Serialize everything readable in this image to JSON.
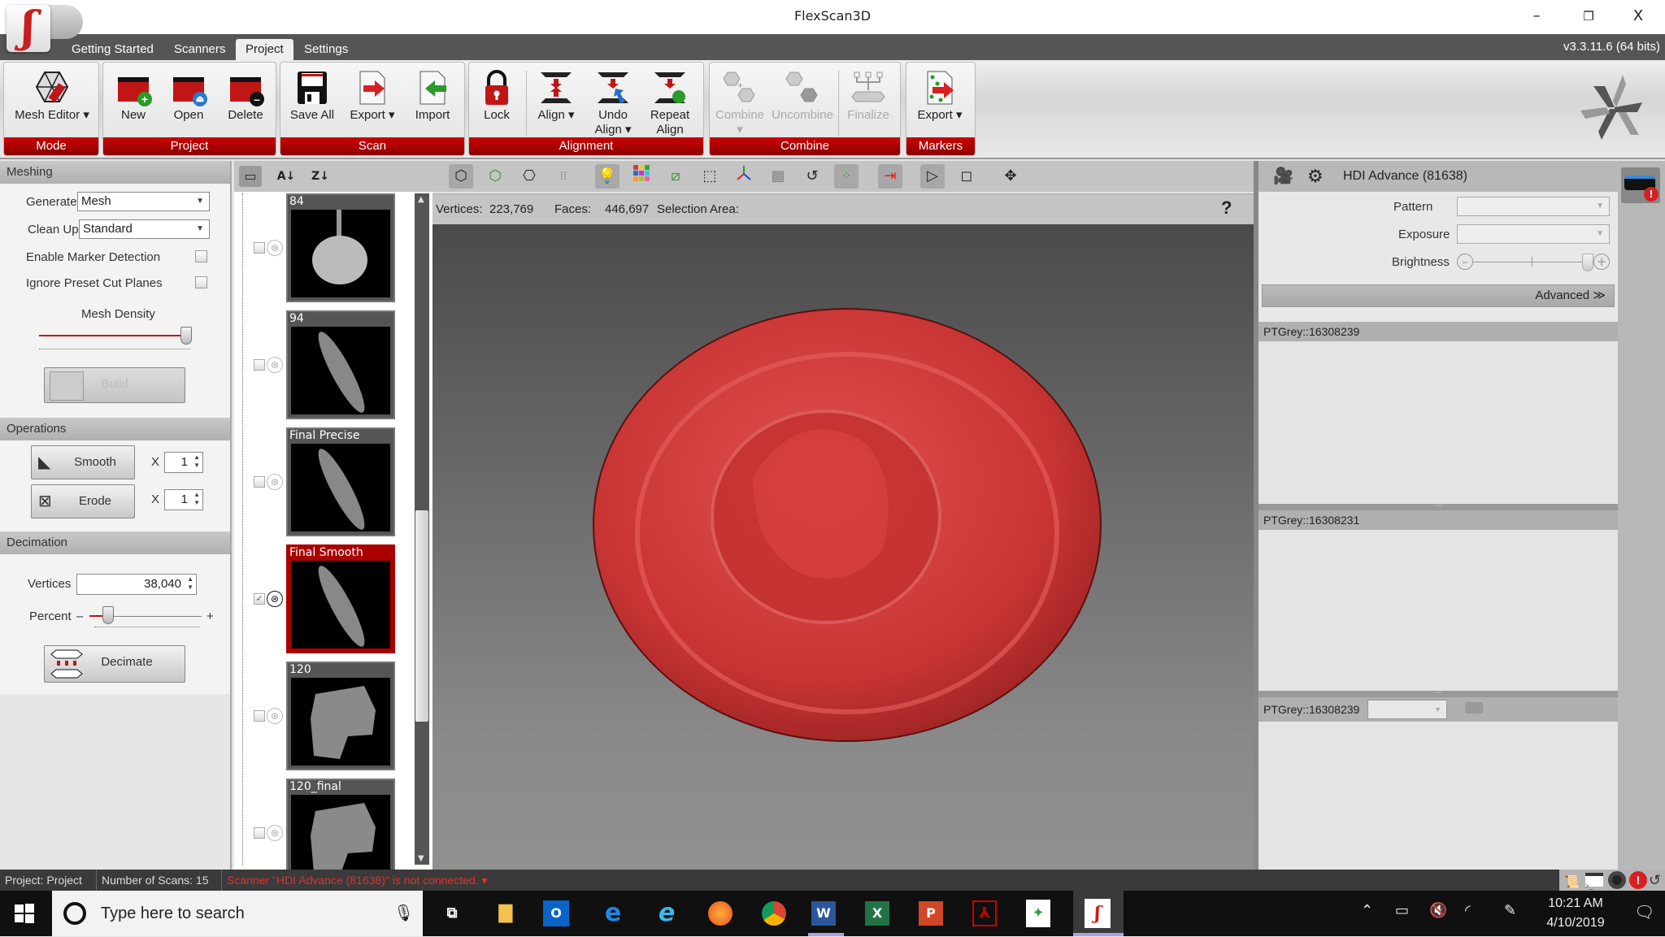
{
  "window": {
    "title": "FlexScan3D",
    "version": "v3.3.11.6  (64 bits)",
    "minimize": "–",
    "restore": "❐",
    "close": "X"
  },
  "tabs": [
    {
      "label": "Getting Started"
    },
    {
      "label": "Scanners"
    },
    {
      "label": "Project",
      "active": true
    },
    {
      "label": "Settings"
    }
  ],
  "ribbon": {
    "groups": {
      "mode": {
        "label": "Mode",
        "buttons": {
          "mesh_editor": "Mesh Editor ▾"
        }
      },
      "project": {
        "label": "Project",
        "buttons": {
          "new": "New",
          "open": "Open",
          "delete": "Delete"
        }
      },
      "scan": {
        "label": "Scan",
        "buttons": {
          "save_all": "Save All",
          "export": "Export ▾",
          "import": "Import"
        }
      },
      "alignment": {
        "label": "Alignment",
        "buttons": {
          "lock": "Lock",
          "align": "Align ▾",
          "undo_align": "Undo Align ▾",
          "repeat_align": "Repeat Align"
        }
      },
      "combine": {
        "label": "Combine",
        "buttons": {
          "combine": "Combine ▾",
          "uncombine": "Uncombine",
          "finalize": "Finalize"
        }
      },
      "markers": {
        "label": "Markers",
        "buttons": {
          "export": "Export ▾"
        }
      }
    }
  },
  "left_panel": {
    "meshing": {
      "title": "Meshing",
      "generate_label": "Generate",
      "generate_value": "Mesh",
      "cleanup_label": "Clean Up",
      "cleanup_value": "Standard",
      "marker_detection_label": "Enable Marker Detection",
      "marker_detection_checked": false,
      "ignore_cut_planes_label": "Ignore Preset Cut Planes",
      "ignore_cut_planes_checked": false,
      "mesh_density_label": "Mesh Density",
      "mesh_density_value": 1.0,
      "build_label": "Build"
    },
    "operations": {
      "title": "Operations",
      "smooth_label": "Smooth",
      "smooth_x": "X",
      "smooth_count": "1",
      "erode_label": "Erode",
      "erode_x": "X",
      "erode_count": "1"
    },
    "decimation": {
      "title": "Decimation",
      "vertices_label": "Vertices",
      "vertices_value": "38,040",
      "percent_label": "Percent",
      "percent_minus": "–",
      "percent_plus": "+",
      "percent_value": 0.17,
      "decimate_label": "Decimate"
    }
  },
  "scans": [
    {
      "name": "84",
      "checked": false,
      "selected": false
    },
    {
      "name": "94",
      "checked": false,
      "selected": false
    },
    {
      "name": "Final Precise",
      "checked": false,
      "selected": false
    },
    {
      "name": "Final Smooth",
      "checked": true,
      "selected": true
    },
    {
      "name": "120",
      "checked": false,
      "selected": false
    },
    {
      "name": "120_final",
      "checked": false,
      "selected": false
    }
  ],
  "viewport": {
    "vertices_label": "Vertices:",
    "vertices_value": "223,769",
    "faces_label": "Faces:",
    "faces_value": "446,697",
    "selection_area_label": "Selection Area:",
    "help": "?",
    "mesh_color": "#d03c3c"
  },
  "right_panel": {
    "scanner_name": "HDI Advance (81638)",
    "pattern_label": "Pattern",
    "pattern_value": "",
    "exposure_label": "Exposure",
    "exposure_value": "",
    "brightness_label": "Brightness",
    "brightness_value": 0.92,
    "advanced_label": "Advanced ≫",
    "cameras": [
      {
        "name": "PTGrey::16308239"
      },
      {
        "name": "PTGrey::16308231"
      },
      {
        "name": "PTGrey::16308239",
        "dropdown_value": ""
      }
    ]
  },
  "statusbar": {
    "project": "Project:  Project",
    "scans": "Number of Scans:  15",
    "message": "Scanner \"HDI Advance (81638)\" is not connected. ▾",
    "message_color": "#e03030"
  },
  "taskbar": {
    "search_placeholder": "Type here to search",
    "time": "10:21 AM",
    "date": "4/10/2019"
  },
  "colors": {
    "accent": "#b00000",
    "selected_scan": "#a00000"
  }
}
